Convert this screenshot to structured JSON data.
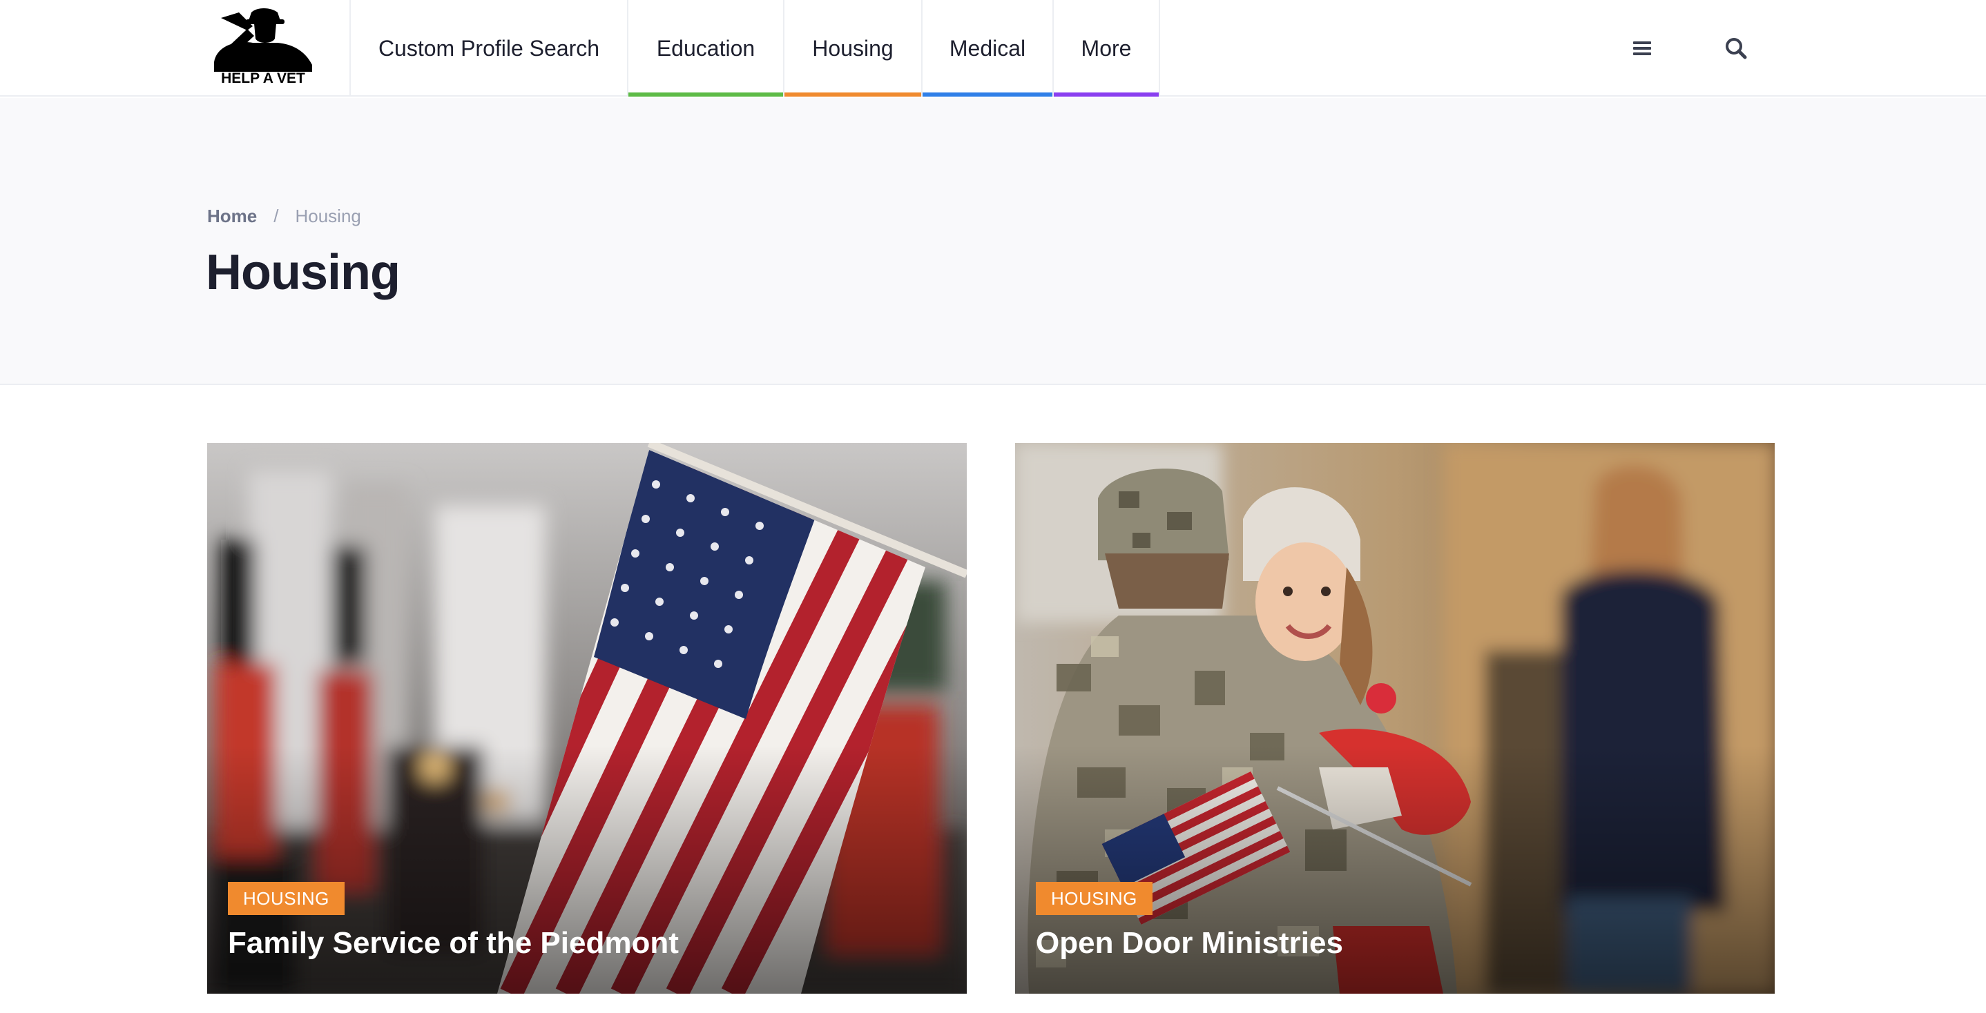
{
  "brand": {
    "logo_text": "HELP A VET"
  },
  "nav": {
    "items": [
      {
        "label": "Custom Profile Search",
        "accent": ""
      },
      {
        "label": "Education",
        "accent": "#5dbb46"
      },
      {
        "label": "Housing",
        "accent": "#f08a2e"
      },
      {
        "label": "Medical",
        "accent": "#2f7fe8"
      },
      {
        "label": "More",
        "accent": "#8a3ff0"
      }
    ],
    "icons": [
      "hamburger-menu-icon",
      "search-icon"
    ]
  },
  "breadcrumb": {
    "home": "Home",
    "separator": "/",
    "current": "Housing"
  },
  "page": {
    "title": "Housing"
  },
  "cards": [
    {
      "badge": "HOUSING",
      "title": "Family Service of the Piedmont",
      "image": "american-flag-parade"
    },
    {
      "badge": "HOUSING",
      "title": "Open Door Ministries",
      "image": "soldier-hugging-child"
    }
  ],
  "colors": {
    "badge": "#f08a2e",
    "text_dark": "#1d1f2e",
    "banner_bg": "#f9f9fb"
  }
}
